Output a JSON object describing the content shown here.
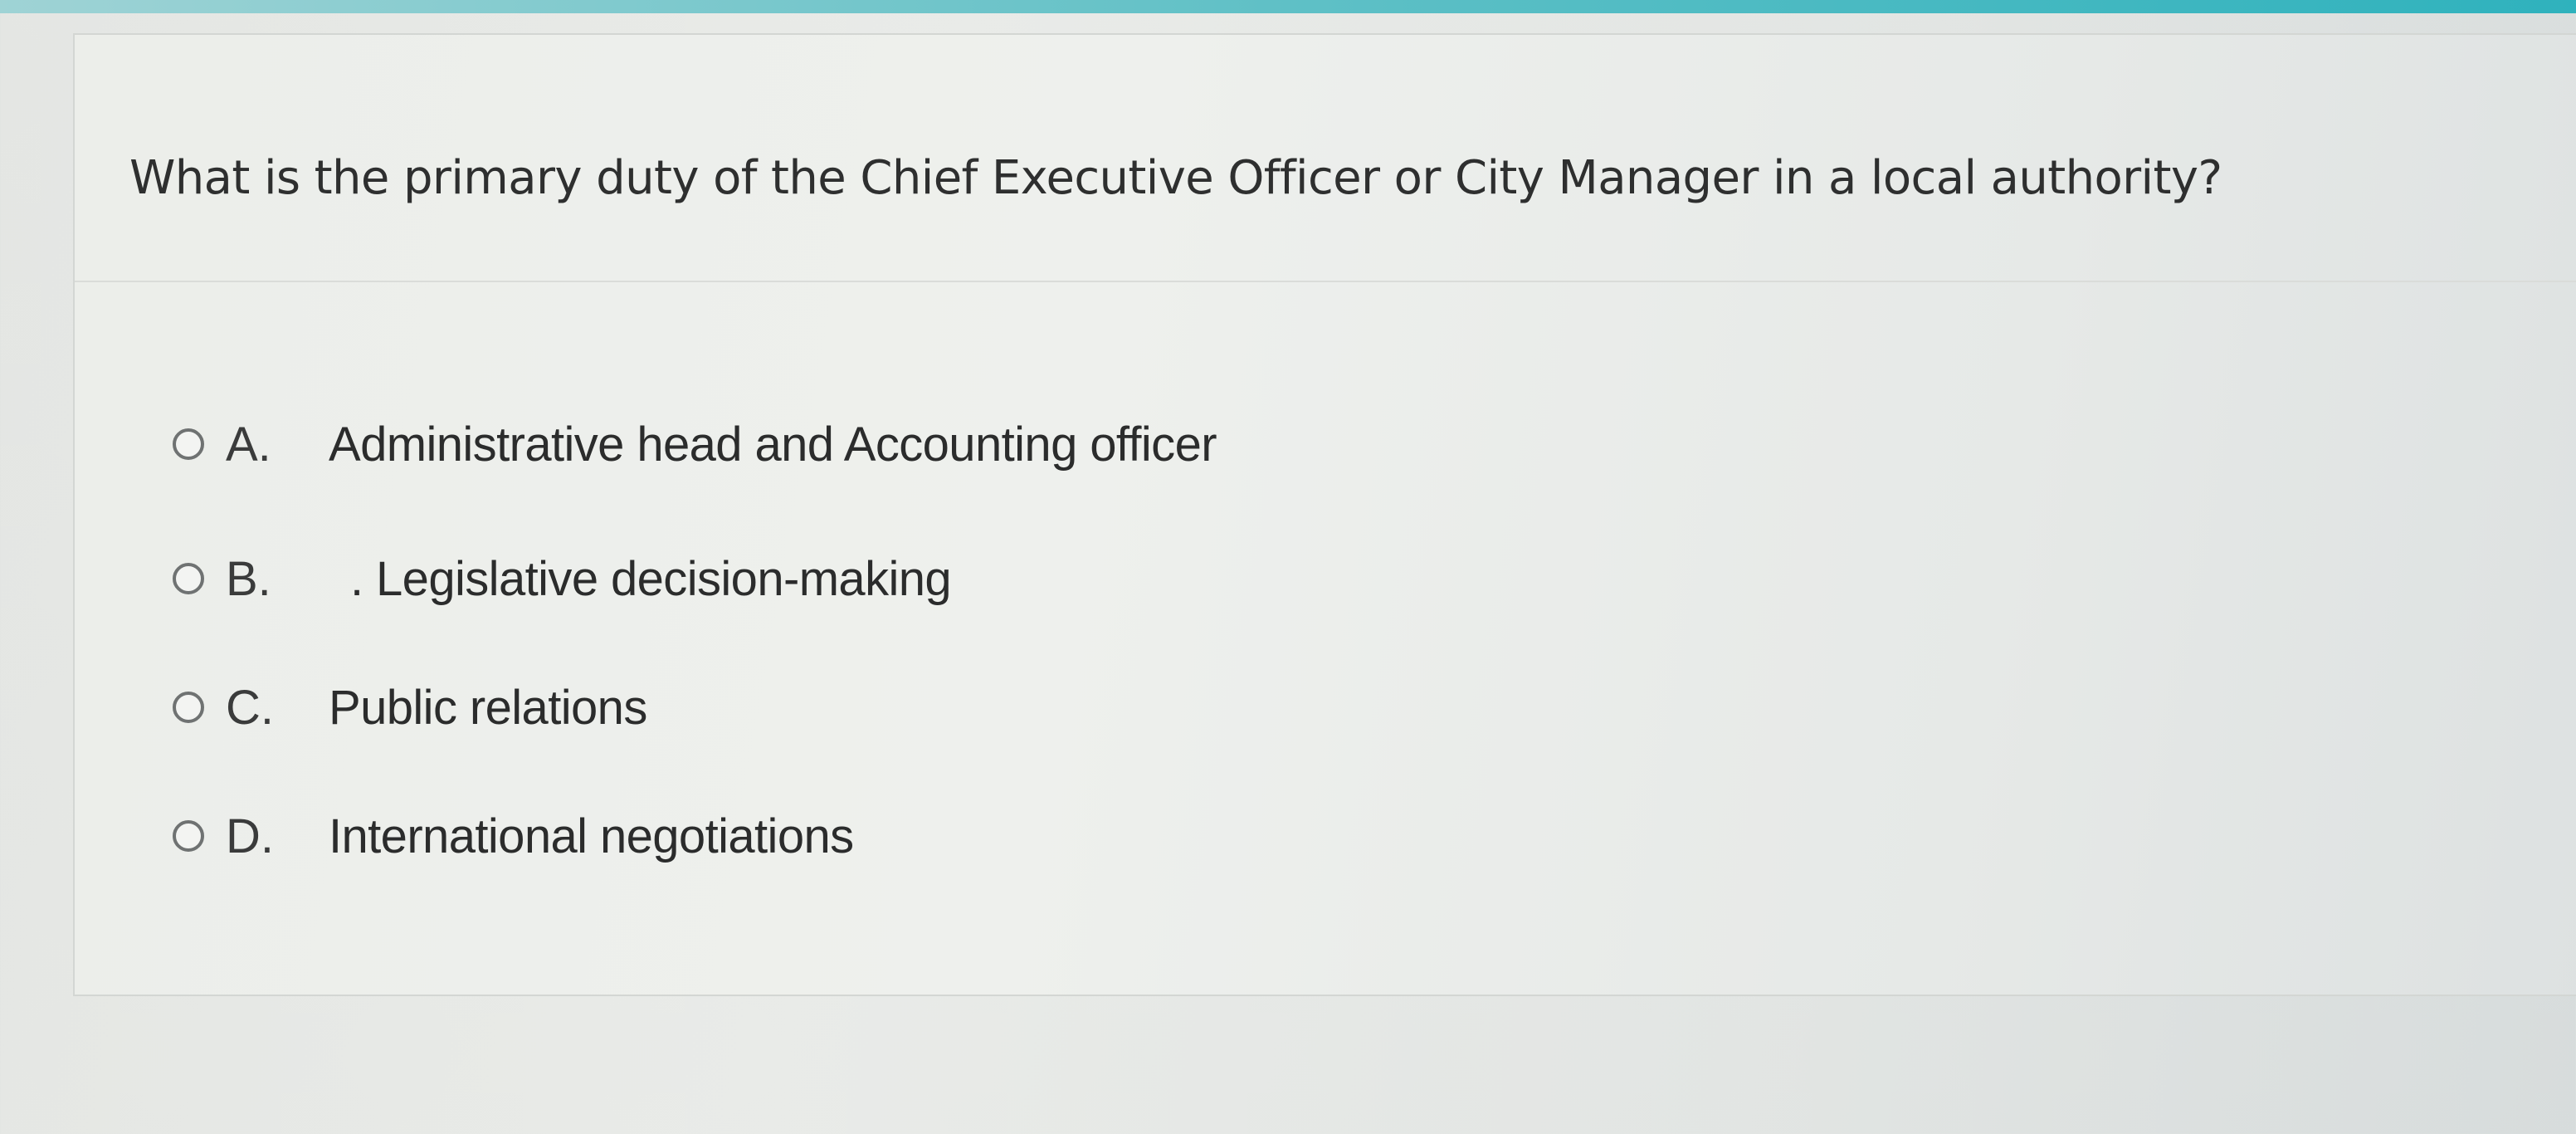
{
  "question": {
    "text": "What is the primary duty of the Chief Executive Officer or City Manager in a local authority?"
  },
  "options": [
    {
      "letter": "A.",
      "text": "Administrative head and Accounting officer",
      "selected": false
    },
    {
      "letter": "B.",
      "text": ". Legislative decision-making",
      "selected": false
    },
    {
      "letter": "C.",
      "text": "Public relations",
      "selected": false
    },
    {
      "letter": "D.",
      "text": "International negotiations",
      "selected": false
    }
  ],
  "colors": {
    "accent_bar": "#2fb2bd",
    "text": "#2e2f2f",
    "radio_border": "#6f7272"
  }
}
